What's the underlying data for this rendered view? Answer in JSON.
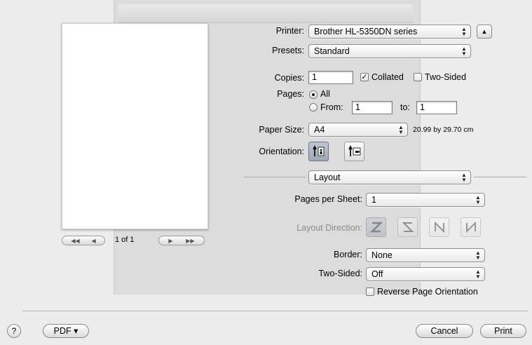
{
  "printer": {
    "label": "Printer:",
    "value": "Brother HL-5350DN series",
    "disclosure": "▲"
  },
  "presets": {
    "label": "Presets:",
    "value": "Standard"
  },
  "copies": {
    "label": "Copies:",
    "value": "1",
    "collated_label": "Collated",
    "collated_checked": true,
    "two_sided_label": "Two-Sided",
    "two_sided_checked": false
  },
  "pages": {
    "label": "Pages:",
    "all_label": "All",
    "from_label": "From:",
    "from_value": "1",
    "to_label": "to:",
    "to_value": "1",
    "selected": "All"
  },
  "paper": {
    "label": "Paper Size:",
    "value": "A4",
    "dimensions": "20.99 by 29.70 cm"
  },
  "orientation": {
    "label": "Orientation:",
    "selected": "portrait"
  },
  "panel": {
    "value": "Layout"
  },
  "pages_per_sheet": {
    "label": "Pages per Sheet:",
    "value": "1"
  },
  "layout_direction": {
    "label": "Layout Direction:"
  },
  "border": {
    "label": "Border:",
    "value": "None"
  },
  "two_sided": {
    "label": "Two-Sided:",
    "value": "Off"
  },
  "reverse": {
    "label": "Reverse Page Orientation",
    "checked": false
  },
  "preview": {
    "page_indicator": "1 of 1"
  },
  "footer": {
    "help": "?",
    "pdf": "PDF ▾",
    "cancel": "Cancel",
    "print": "Print"
  }
}
